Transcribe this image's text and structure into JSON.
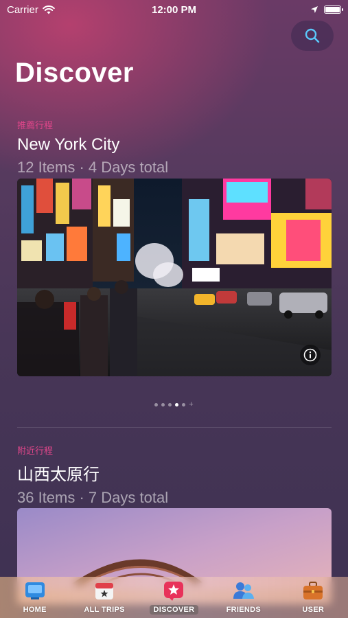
{
  "status_bar": {
    "carrier": "Carrier",
    "time": "12:00 PM"
  },
  "header": {
    "title": "Discover"
  },
  "sections": [
    {
      "tag": "推薦行程",
      "name": "New York City",
      "meta": "12 Items · 4 Days total"
    },
    {
      "tag": "附近行程",
      "name": "山西太原行",
      "meta": "36 Items · 7 Days total"
    }
  ],
  "pager": {
    "page_count": 5,
    "active_index": 3
  },
  "tab_bar": {
    "items": [
      {
        "label": "HOME",
        "icon": "home-icon"
      },
      {
        "label": "ALL TRIPS",
        "icon": "calendar-icon"
      },
      {
        "label": "DISCOVER",
        "icon": "star-icon",
        "active": true
      },
      {
        "label": "FRIENDS",
        "icon": "friends-icon"
      },
      {
        "label": "USER",
        "icon": "briefcase-icon"
      }
    ]
  },
  "colors": {
    "accent_tag": "#e0468a",
    "search_icon": "#5ac8fa"
  }
}
